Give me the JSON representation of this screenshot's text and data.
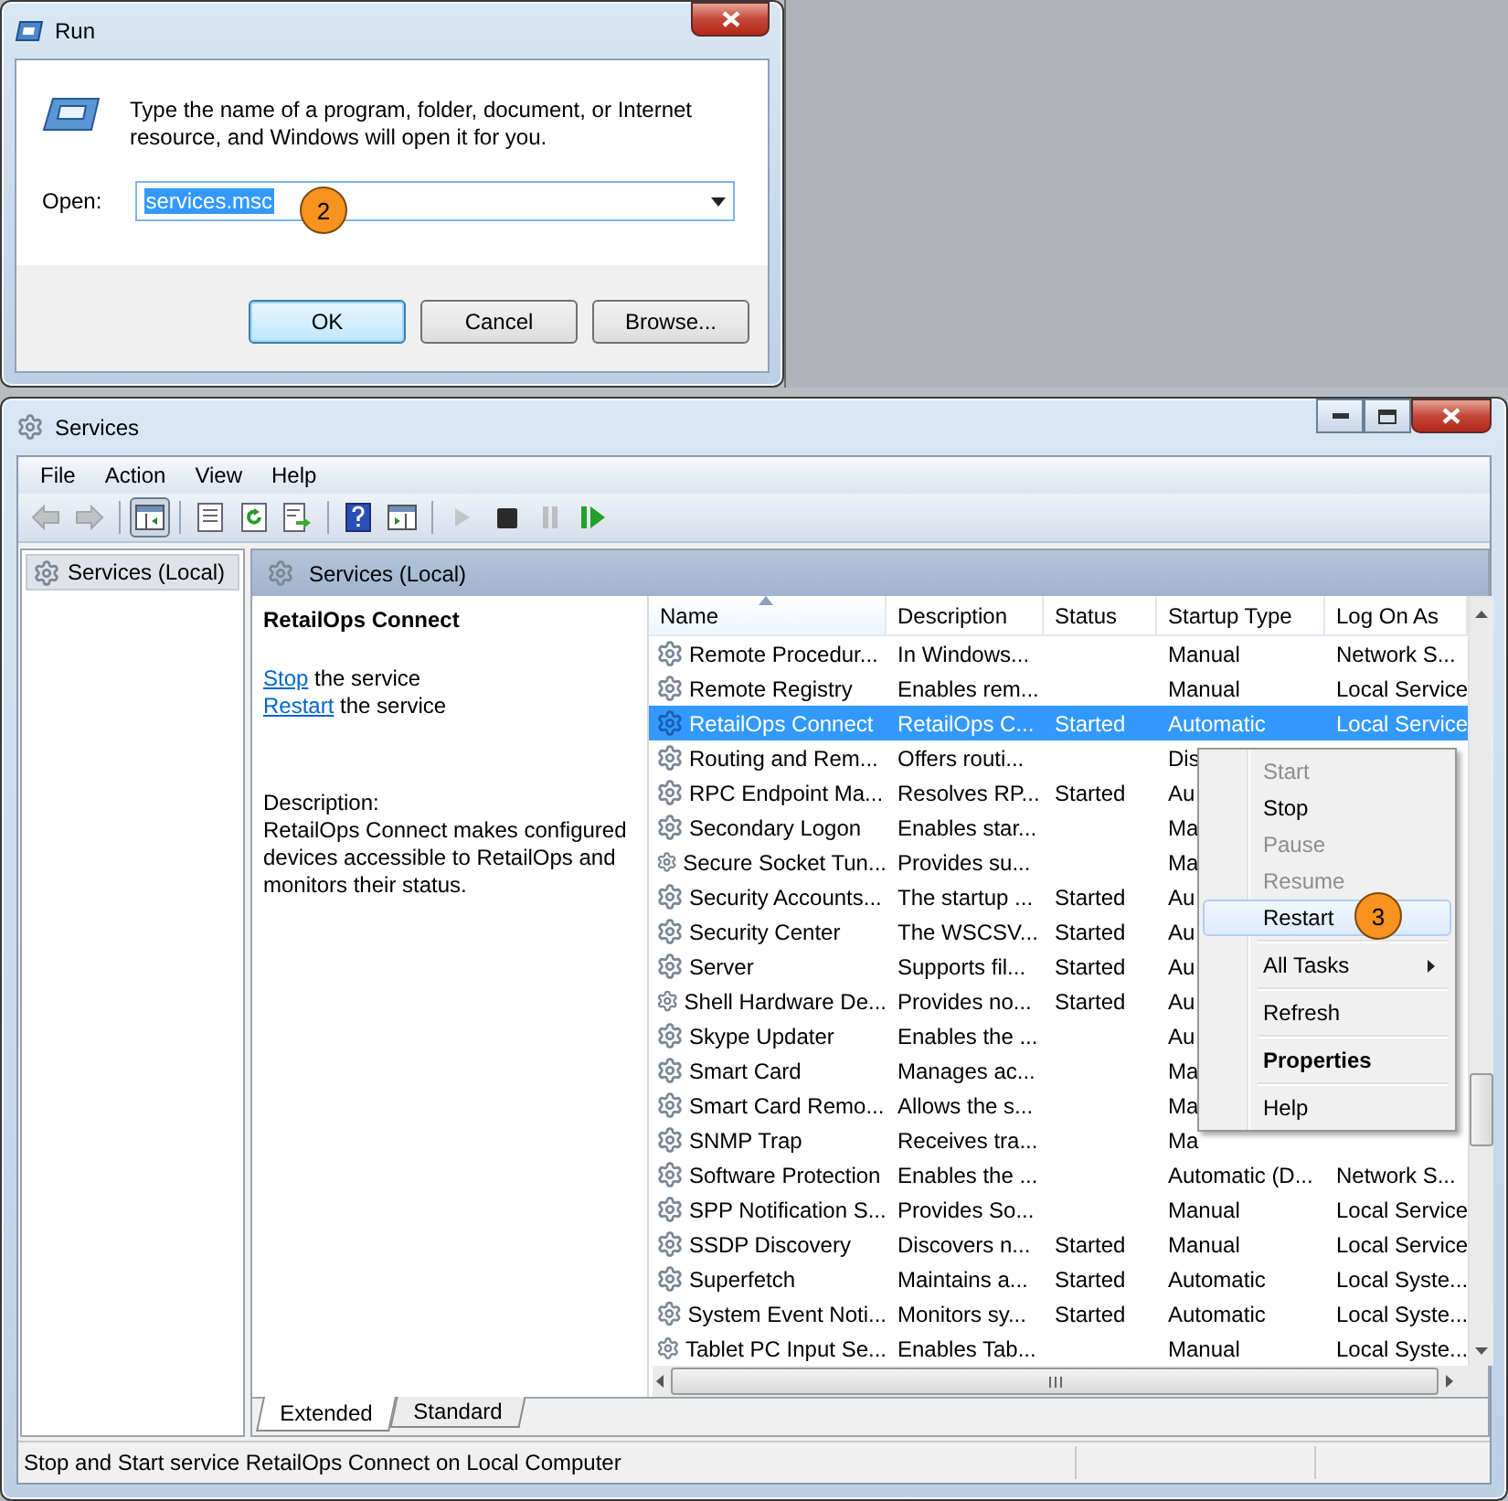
{
  "run_dialog": {
    "title": "Run",
    "prompt": "Type the name of a program, folder, document, or Internet resource, and Windows will open it for you.",
    "open_label": "Open:",
    "open_value": "services.msc",
    "value_selected": true,
    "callout": "2",
    "buttons": [
      {
        "label": "OK",
        "default": true
      },
      {
        "label": "Cancel",
        "default": false
      },
      {
        "label": "Browse...",
        "default": false
      }
    ]
  },
  "services_window": {
    "title": "Services",
    "menu": [
      "File",
      "Action",
      "View",
      "Help"
    ],
    "toolbar": [
      {
        "kind": "back",
        "disabled": true,
        "pressed": false
      },
      {
        "kind": "forward",
        "disabled": true,
        "pressed": false
      },
      {
        "kind": "console-tree",
        "disabled": false,
        "pressed": true
      },
      {
        "kind": "properties",
        "disabled": false,
        "pressed": false
      },
      {
        "kind": "refresh",
        "disabled": false,
        "pressed": false
      },
      {
        "kind": "export",
        "disabled": false,
        "pressed": false
      },
      {
        "kind": "help",
        "disabled": false,
        "pressed": false
      },
      {
        "kind": "action-pane",
        "disabled": false,
        "pressed": false
      },
      {
        "kind": "start",
        "disabled": true,
        "pressed": false
      },
      {
        "kind": "stop",
        "disabled": false,
        "pressed": false
      },
      {
        "kind": "pause",
        "disabled": true,
        "pressed": false
      },
      {
        "kind": "resume",
        "disabled": false,
        "pressed": false
      }
    ],
    "tree": [
      {
        "label": "Services (Local)",
        "selected": true
      }
    ],
    "pane_header": "Services (Local)",
    "details": {
      "title": "RetailOps Connect",
      "actions": [
        {
          "link": "Stop",
          "text": " the service"
        },
        {
          "link": "Restart",
          "text": " the service"
        }
      ],
      "description_label": "Description:",
      "description": "RetailOps Connect makes configured devices accessible to RetailOps and monitors their status."
    },
    "columns": [
      {
        "label": "Name",
        "sorted": true
      },
      {
        "label": "Description",
        "sorted": false
      },
      {
        "label": "Status",
        "sorted": false
      },
      {
        "label": "Startup Type",
        "sorted": false
      },
      {
        "label": "Log On As",
        "sorted": false
      }
    ],
    "rows": [
      {
        "name": "Remote Procedur...",
        "description": "In Windows...",
        "startup_type": "Manual",
        "log_on_as": "Network S...",
        "selected": false
      },
      {
        "name": "Remote Registry",
        "description": "Enables rem...",
        "startup_type": "Manual",
        "log_on_as": "Local Service",
        "selected": false
      },
      {
        "name": "RetailOps Connect",
        "description": "RetailOps C...",
        "status": "Started",
        "startup_type": "Automatic",
        "log_on_as": "Local Service",
        "selected": true
      },
      {
        "name": "Routing and Rem...",
        "description": "Offers routi...",
        "startup_type": "Dis",
        "selected": false
      },
      {
        "name": "RPC Endpoint Ma...",
        "description": "Resolves RP...",
        "status": "Started",
        "startup_type": "Au",
        "selected": false
      },
      {
        "name": "Secondary Logon",
        "description": "Enables star...",
        "startup_type": "Ma",
        "selected": false
      },
      {
        "name": "Secure Socket Tun...",
        "description": "Provides su...",
        "startup_type": "Ma",
        "selected": false
      },
      {
        "name": "Security Accounts...",
        "description": "The startup ...",
        "status": "Started",
        "startup_type": "Au",
        "selected": false
      },
      {
        "name": "Security Center",
        "description": "The WSCSV...",
        "status": "Started",
        "startup_type": "Au",
        "selected": false
      },
      {
        "name": "Server",
        "description": "Supports fil...",
        "status": "Started",
        "startup_type": "Au",
        "selected": false
      },
      {
        "name": "Shell Hardware De...",
        "description": "Provides no...",
        "status": "Started",
        "startup_type": "Au",
        "selected": false
      },
      {
        "name": "Skype Updater",
        "description": "Enables the ...",
        "startup_type": "Au",
        "selected": false
      },
      {
        "name": "Smart Card",
        "description": "Manages ac...",
        "startup_type": "Ma",
        "selected": false
      },
      {
        "name": "Smart Card Remo...",
        "description": "Allows the s...",
        "startup_type": "Ma",
        "selected": false
      },
      {
        "name": "SNMP Trap",
        "description": "Receives tra...",
        "startup_type": "Ma",
        "selected": false
      },
      {
        "name": "Software Protection",
        "description": "Enables the ...",
        "startup_type": "Automatic (D...",
        "log_on_as": "Network S...",
        "selected": false
      },
      {
        "name": "SPP Notification S...",
        "description": "Provides So...",
        "startup_type": "Manual",
        "log_on_as": "Local Service",
        "selected": false
      },
      {
        "name": "SSDP Discovery",
        "description": "Discovers n...",
        "status": "Started",
        "startup_type": "Manual",
        "log_on_as": "Local Service",
        "selected": false
      },
      {
        "name": "Superfetch",
        "description": "Maintains a...",
        "status": "Started",
        "startup_type": "Automatic",
        "log_on_as": "Local Syste...",
        "selected": false
      },
      {
        "name": "System Event Noti...",
        "description": "Monitors sy...",
        "status": "Started",
        "startup_type": "Automatic",
        "log_on_as": "Local Syste...",
        "selected": false
      },
      {
        "name": "Tablet PC Input Se...",
        "description": "Enables Tab...",
        "startup_type": "Manual",
        "log_on_as": "Local Syste...",
        "selected": false
      }
    ],
    "context_menu": {
      "callout": "3",
      "items": [
        {
          "kind": "item",
          "label": "Start",
          "disabled": true,
          "bold": false,
          "highlighted": false
        },
        {
          "kind": "item",
          "label": "Stop",
          "disabled": false,
          "bold": false,
          "highlighted": false
        },
        {
          "kind": "item",
          "label": "Pause",
          "disabled": true,
          "bold": false,
          "highlighted": false
        },
        {
          "kind": "item",
          "label": "Resume",
          "disabled": true,
          "bold": false,
          "highlighted": false
        },
        {
          "kind": "item",
          "label": "Restart",
          "disabled": false,
          "bold": false,
          "highlighted": true
        },
        {
          "kind": "separator"
        },
        {
          "kind": "submenu",
          "label": "All Tasks",
          "disabled": false,
          "bold": false,
          "highlighted": false
        },
        {
          "kind": "separator"
        },
        {
          "kind": "item",
          "label": "Refresh",
          "disabled": false,
          "bold": false,
          "highlighted": false
        },
        {
          "kind": "separator"
        },
        {
          "kind": "item",
          "label": "Properties",
          "disabled": false,
          "bold": true,
          "highlighted": false
        },
        {
          "kind": "separator"
        },
        {
          "kind": "item",
          "label": "Help",
          "disabled": false,
          "bold": false,
          "highlighted": false
        }
      ]
    },
    "tabs": [
      {
        "label": "Extended",
        "selected": true
      },
      {
        "label": "Standard",
        "selected": false
      }
    ],
    "status_bar": "Stop and Start service RetailOps Connect on Local Computer"
  }
}
